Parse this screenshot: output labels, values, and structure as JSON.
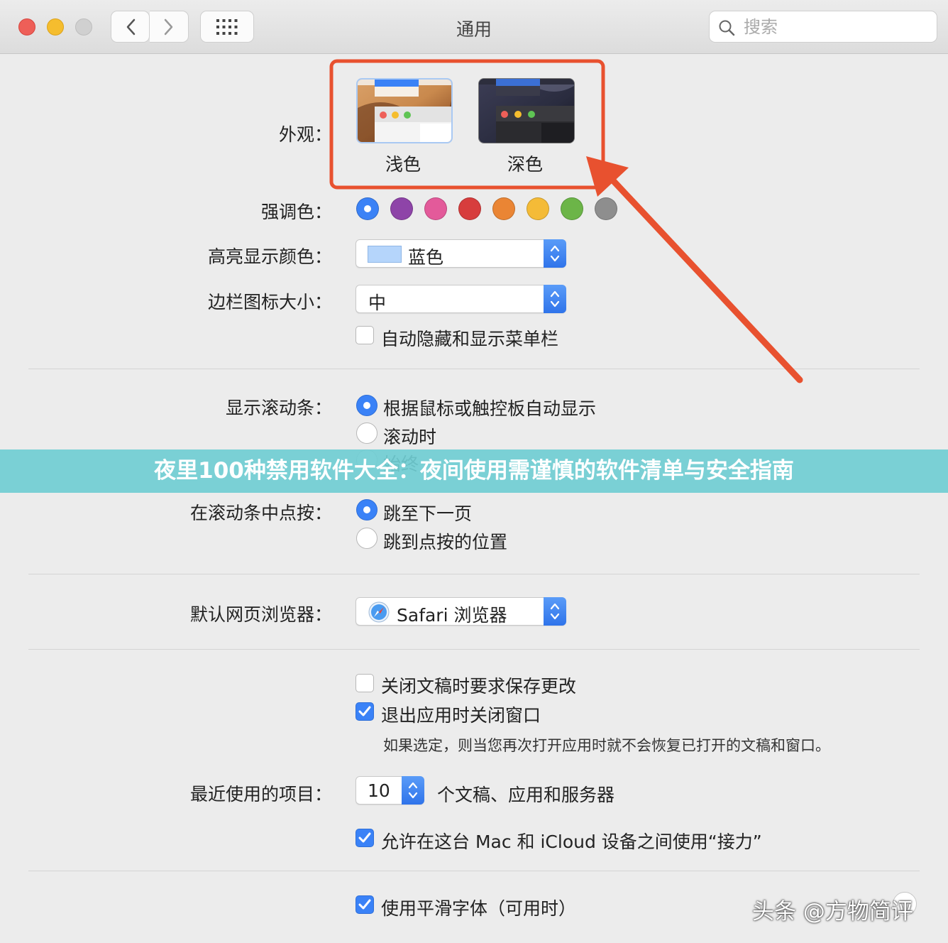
{
  "window": {
    "title": "通用"
  },
  "search": {
    "placeholder": "搜索"
  },
  "appearance": {
    "label": "外观：",
    "options": [
      {
        "label": "浅色",
        "selected": true
      },
      {
        "label": "深色",
        "selected": false
      }
    ]
  },
  "accent": {
    "label": "强调色：",
    "colors": [
      "#3b82f6",
      "#8e44a8",
      "#e35a9a",
      "#d73d3d",
      "#ea8534",
      "#f4bb37",
      "#6cb548",
      "#8e8e8e"
    ],
    "selected_index": 0
  },
  "highlight": {
    "label": "高亮显示颜色：",
    "value": "蓝色",
    "swatch": "#b5d5fb"
  },
  "sidebar_icon": {
    "label": "边栏图标大小：",
    "value": "中"
  },
  "menubar": {
    "label": "自动隐藏和显示菜单栏",
    "checked": false
  },
  "scrollbars": {
    "label": "显示滚动条：",
    "options": [
      "根据鼠标或触控板自动显示",
      "滚动时",
      "始终"
    ],
    "selected_index": 0
  },
  "scroll_click": {
    "label": "在滚动条中点按：",
    "options": [
      "跳至下一页",
      "跳到点按的位置"
    ],
    "selected_index": 0
  },
  "browser": {
    "label": "默认网页浏览器：",
    "value": "Safari 浏览器"
  },
  "documents": {
    "ask_save": {
      "label": "关闭文稿时要求保存更改",
      "checked": false
    },
    "close_windows": {
      "label": "退出应用时关闭窗口",
      "checked": true
    },
    "note": "如果选定，则当您再次打开应用时就不会恢复已打开的文稿和窗口。"
  },
  "recent": {
    "label": "最近使用的项目：",
    "value": "10",
    "suffix": "个文稿、应用和服务器"
  },
  "handoff": {
    "label": "允许在这台 Mac 和 iCloud 设备之间使用“接力”",
    "checked": true
  },
  "smoothing": {
    "label": "使用平滑字体（可用时）",
    "checked": true
  },
  "overlay": {
    "banner": "夜里100种禁用软件大全：夜间使用需谨慎的软件清单与安全指南",
    "watermark": "头条 @方物简评",
    "highlight_color": "#e8512f"
  },
  "colors": {
    "accent": "#3a82f7",
    "window_bg": "#ececec"
  }
}
